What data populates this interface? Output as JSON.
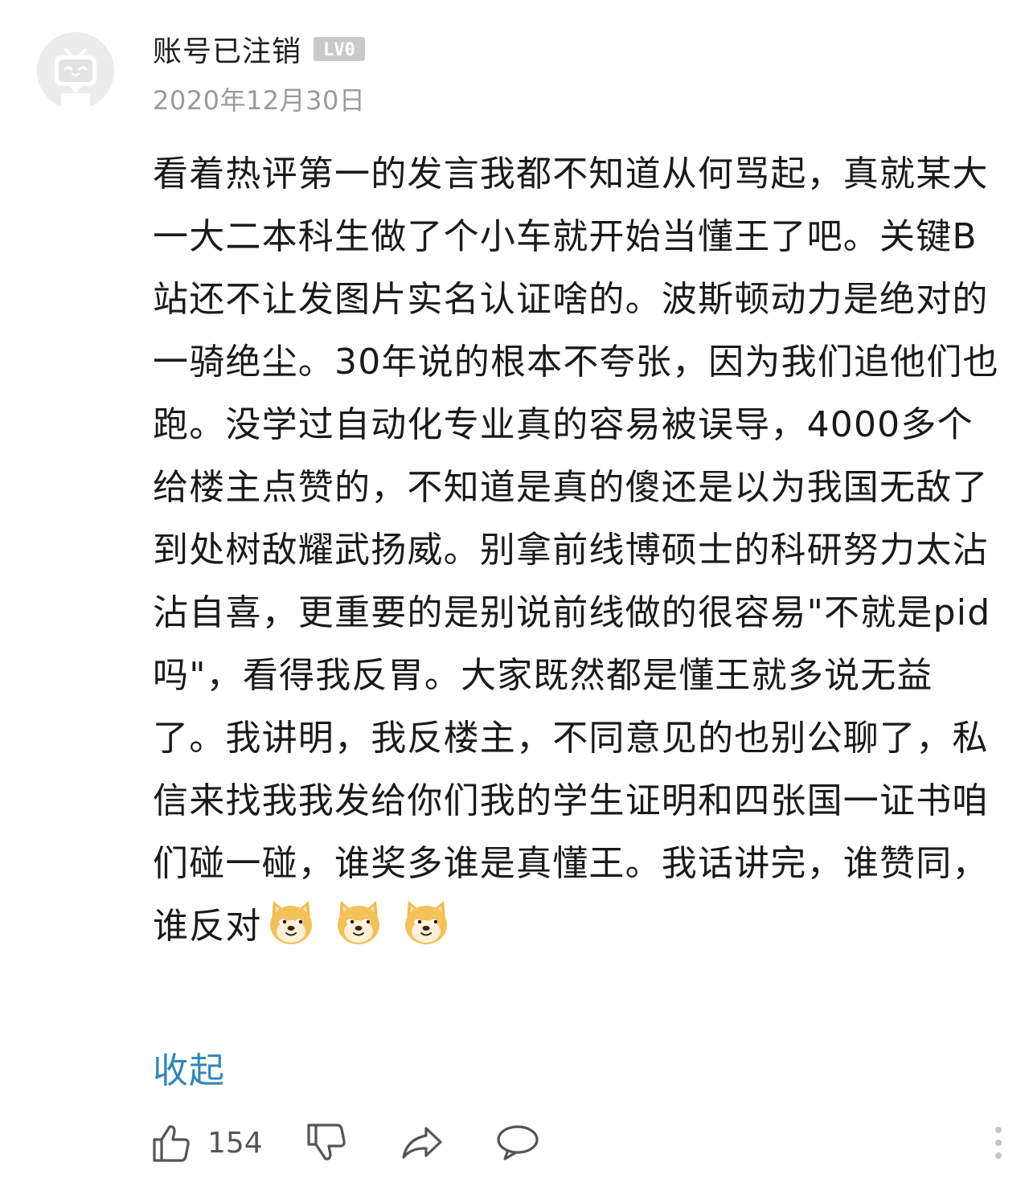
{
  "comment": {
    "user": {
      "name": "账号已注销",
      "level_badge": "LV0",
      "avatar_icon": "bilibili-tv-avatar-icon"
    },
    "date": "2020年12月30日",
    "text": "看着热评第一的发言我都不知道从何骂起，真就某大一大二本科生做了个小车就开始当懂王了吧。关键B站还不让发图片实名认证啥的。波斯顿动力是绝对的一骑绝尘。30年说的根本不夸张，因为我们追他们也跑。没学过自动化专业真的容易被误导，4000多个给楼主点赞的，不知道是真的傻还是以为我国无敌了到处树敌耀武扬威。别拿前线博硕士的科研努力太沾沾自喜，更重要的是别说前线做的很容易\"不就是pid吗\"，看得我反胃。大家既然都是懂王就多说无益了。我讲明，我反楼主，不同意见的也别公聊了，私信来找我我发给你们我的学生证明和四张国一证书咱们碰一碰，谁奖多谁是真懂王。我话讲完，谁赞同，谁反对",
    "emojis": [
      "doge-emoji",
      "doge-emoji",
      "doge-emoji"
    ],
    "collapse_label": "收起",
    "actions": {
      "like_count": "154",
      "like_icon": "thumbs-up-icon",
      "dislike_icon": "thumbs-down-icon",
      "share_icon": "share-icon",
      "reply_icon": "comment-bubble-icon",
      "more_icon": "more-vertical-icon"
    }
  },
  "colors": {
    "link": "#2f86b8",
    "muted": "#9a9a9a",
    "text": "#1a1a1a"
  }
}
